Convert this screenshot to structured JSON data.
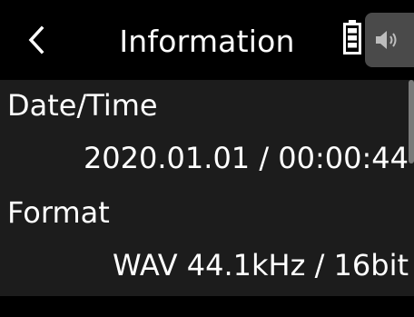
{
  "header": {
    "title": "Information",
    "back_icon": "chevron-left-icon",
    "battery_icon": "battery-icon",
    "speaker_icon": "speaker-icon"
  },
  "info": {
    "items": [
      {
        "label": "Date/Time",
        "value": "2020.01.01 / 00:00:44"
      },
      {
        "label": "Format",
        "value": "WAV 44.1kHz / 16bit"
      }
    ]
  },
  "colors": {
    "background": "#000000",
    "panel": "#1c1c1c",
    "text": "#ffffff",
    "speaker_tab": "#4a4a4a",
    "scrollbar": "#7a7a7a"
  }
}
